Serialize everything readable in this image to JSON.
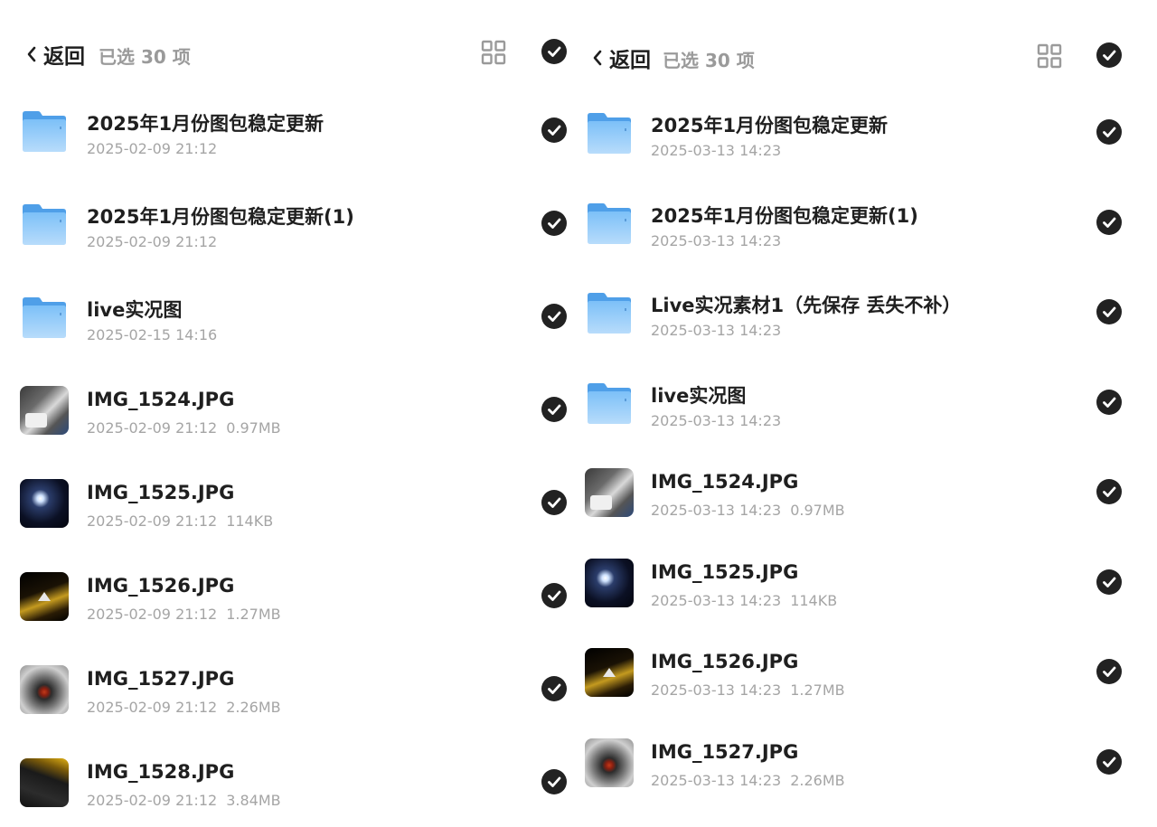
{
  "colors": {
    "check_bg": "#222222",
    "folder": "#6db4f5",
    "meta_text": "#a5a5a5"
  },
  "left": {
    "header": {
      "back_label": "返回",
      "selected_text": "已选 30 项"
    },
    "items": [
      {
        "kind": "folder",
        "name": "2025年1月份图包稳定更新",
        "date": "2025-02-09 21:12",
        "size": ""
      },
      {
        "kind": "folder",
        "name": "2025年1月份图包稳定更新(1)",
        "date": "2025-02-09 21:12",
        "size": ""
      },
      {
        "kind": "folder",
        "name": "live实况图",
        "date": "2025-02-15 14:16",
        "size": ""
      },
      {
        "kind": "photo",
        "thumb": "car-interior",
        "name": "IMG_1524.JPG",
        "date": "2025-02-09 21:12",
        "size": "0.97MB"
      },
      {
        "kind": "photo",
        "thumb": "dark-light",
        "name": "IMG_1525.JPG",
        "date": "2025-02-09 21:12",
        "size": "114KB"
      },
      {
        "kind": "photo",
        "thumb": "gold-interior",
        "name": "IMG_1526.JPG",
        "date": "2025-02-09 21:12",
        "size": "1.27MB"
      },
      {
        "kind": "photo",
        "thumb": "steering",
        "name": "IMG_1527.JPG",
        "date": "2025-02-09 21:12",
        "size": "2.26MB"
      },
      {
        "kind": "photo",
        "thumb": "dash-yellow",
        "name": "IMG_1528.JPG",
        "date": "2025-02-09 21:12",
        "size": "3.84MB"
      }
    ]
  },
  "right": {
    "header": {
      "back_label": "返回",
      "selected_text": "已选 30 项"
    },
    "items": [
      {
        "kind": "folder",
        "name": "2025年1月份图包稳定更新",
        "date": "2025-03-13 14:23",
        "size": ""
      },
      {
        "kind": "folder",
        "name": "2025年1月份图包稳定更新(1)",
        "date": "2025-03-13 14:23",
        "size": ""
      },
      {
        "kind": "folder",
        "name": "Live实况素材1（先保存 丢失不补）",
        "date": "2025-03-13 14:23",
        "size": ""
      },
      {
        "kind": "folder",
        "name": "live实况图",
        "date": "2025-03-13 14:23",
        "size": ""
      },
      {
        "kind": "photo",
        "thumb": "car-interior",
        "name": "IMG_1524.JPG",
        "date": "2025-03-13 14:23",
        "size": "0.97MB"
      },
      {
        "kind": "photo",
        "thumb": "dark-light",
        "name": "IMG_1525.JPG",
        "date": "2025-03-13 14:23",
        "size": "114KB"
      },
      {
        "kind": "photo",
        "thumb": "gold-interior",
        "name": "IMG_1526.JPG",
        "date": "2025-03-13 14:23",
        "size": "1.27MB"
      },
      {
        "kind": "photo",
        "thumb": "steering",
        "name": "IMG_1527.JPG",
        "date": "2025-03-13 14:23",
        "size": "2.26MB"
      }
    ]
  }
}
